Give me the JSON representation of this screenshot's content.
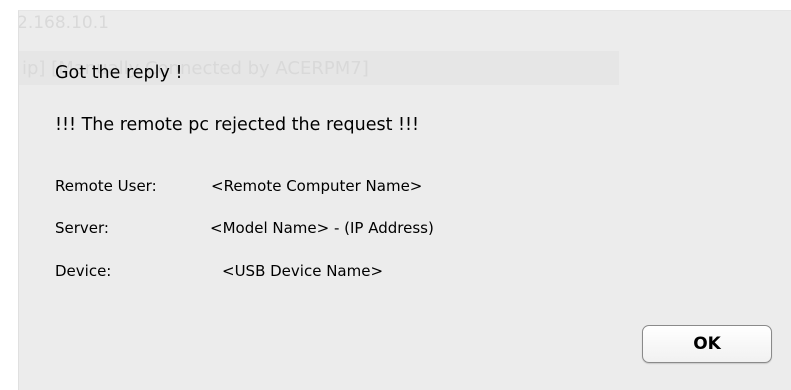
{
  "background_text": {
    "ip": "2.168.10.1",
    "connection": "ip] [Manually Connected by ACERPM7]"
  },
  "dialog": {
    "title": "Got the reply !",
    "message": "!!! The remote pc rejected the request !!!",
    "fields": [
      {
        "label": "Remote User:",
        "value": "<Remote Computer Name>"
      },
      {
        "label": "Server:",
        "value": "<Model Name> - (IP Address)"
      },
      {
        "label": "Device:",
        "value": "<USB Device Name>"
      }
    ],
    "ok_label": "OK"
  }
}
